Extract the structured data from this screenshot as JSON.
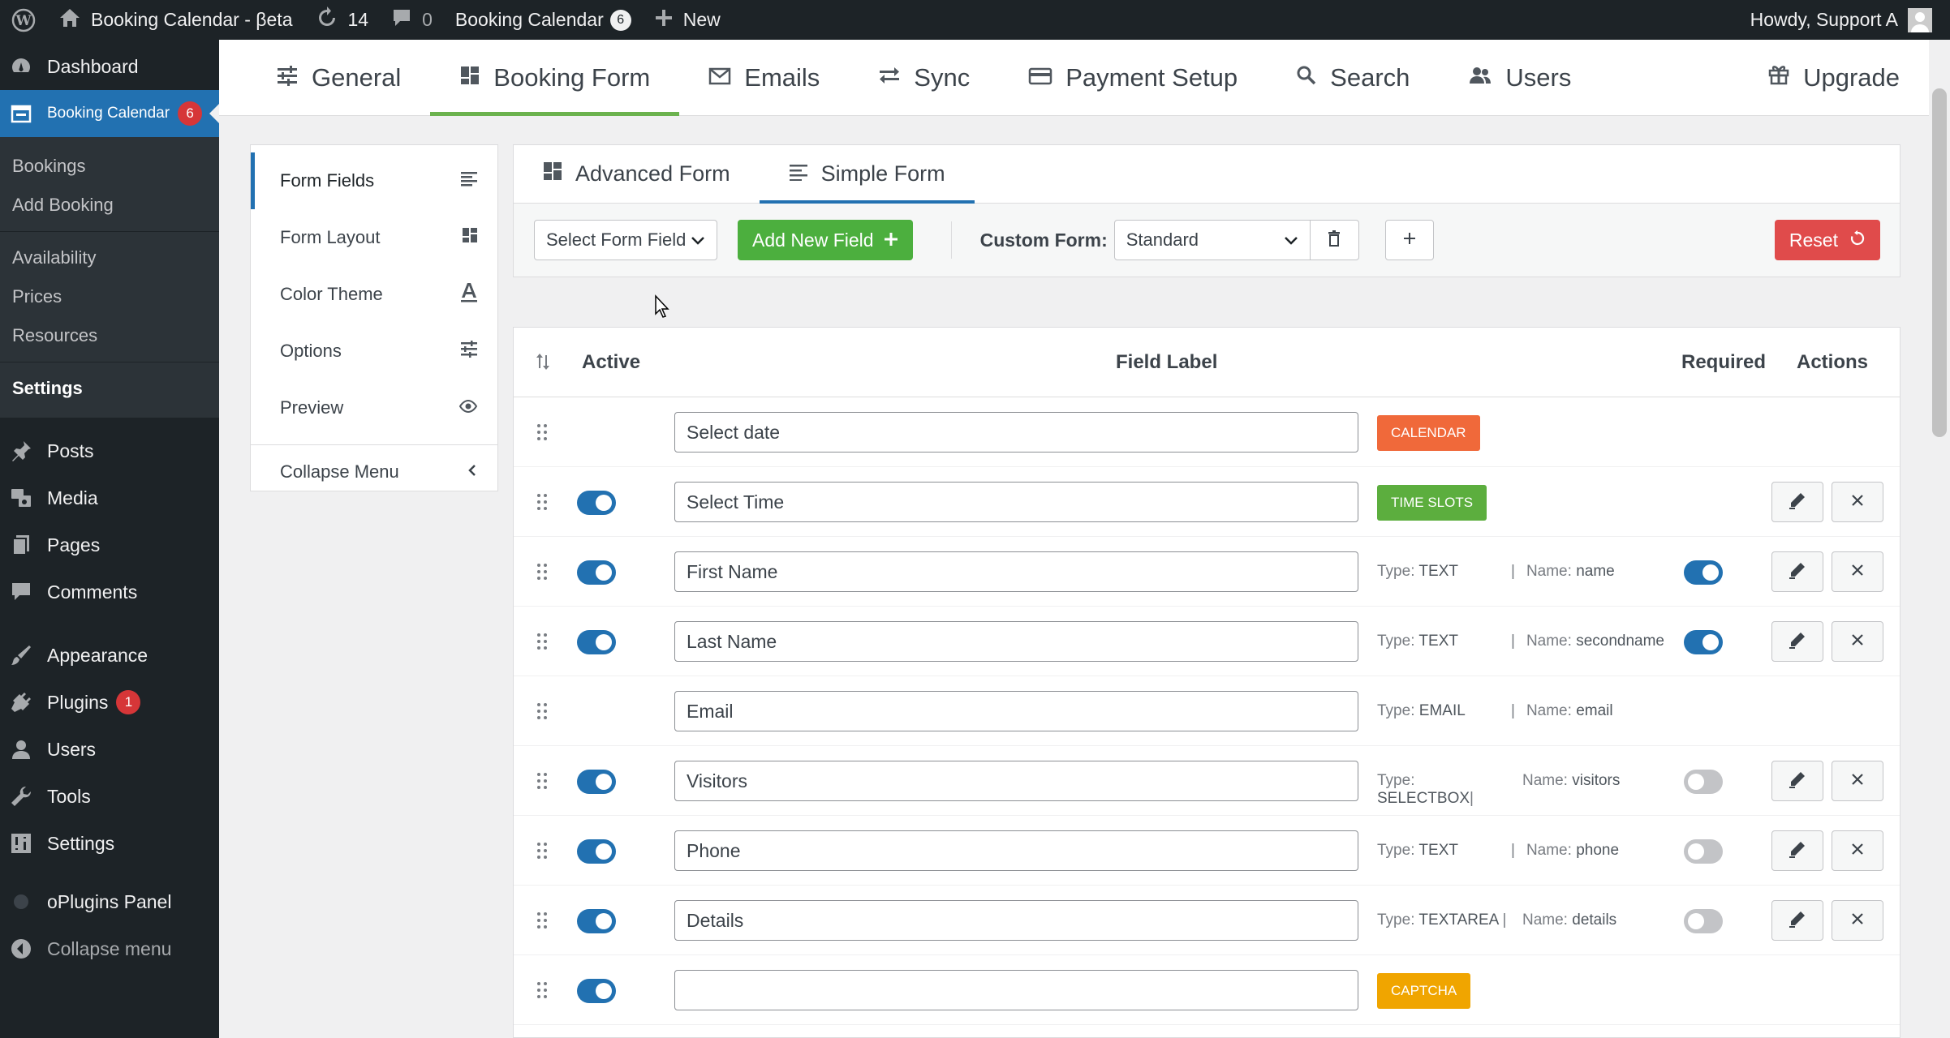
{
  "adminbar": {
    "site_name": "Booking Calendar - βeta",
    "updates_count": "14",
    "comments_count": "0",
    "plugin_label": "Booking Calendar",
    "plugin_count": "6",
    "new_label": "New",
    "greeting": "Howdy, Support A"
  },
  "sidebar": {
    "dashboard": "Dashboard",
    "booking_calendar": "Booking Calendar",
    "booking_calendar_badge": "6",
    "sub": {
      "bookings": "Bookings",
      "add_booking": "Add Booking",
      "availability": "Availability",
      "prices": "Prices",
      "resources": "Resources",
      "settings": "Settings"
    },
    "posts": "Posts",
    "media": "Media",
    "pages": "Pages",
    "comments": "Comments",
    "appearance": "Appearance",
    "plugins": "Plugins",
    "plugins_badge": "1",
    "users": "Users",
    "tools": "Tools",
    "settings": "Settings",
    "oplugins": "oPlugins Panel",
    "collapse": "Collapse menu"
  },
  "topnav": {
    "general": "General",
    "booking_form": "Booking Form",
    "emails": "Emails",
    "sync": "Sync",
    "payment_setup": "Payment Setup",
    "search": "Search",
    "users": "Users",
    "upgrade": "Upgrade"
  },
  "leftmenu": {
    "form_fields": "Form Fields",
    "form_layout": "Form Layout",
    "color_theme": "Color Theme",
    "options": "Options",
    "preview": "Preview",
    "collapse": "Collapse Menu"
  },
  "form_tabs": {
    "advanced": "Advanced Form",
    "simple": "Simple Form"
  },
  "toolbar": {
    "select_field": "Select Form Field",
    "add_new": "Add New Field",
    "custom_form_label": "Custom Form:",
    "custom_form_value": "Standard",
    "reset": "Reset"
  },
  "table": {
    "headers": {
      "active": "Active",
      "field_label": "Field Label",
      "required": "Required",
      "actions": "Actions"
    },
    "type_label": "Type:",
    "name_label": "Name:",
    "rows": [
      {
        "label": "Select date",
        "tag": "CALENDAR",
        "tag_color": "#f0693a"
      },
      {
        "label": "Select Time",
        "tag": "TIME SLOTS",
        "tag_color": "#5cae3e"
      },
      {
        "label": "First Name",
        "type": "TEXT",
        "name": "name"
      },
      {
        "label": "Last Name",
        "type": "TEXT",
        "name": "secondname"
      },
      {
        "label": "Email",
        "type": "EMAIL",
        "name": "email"
      },
      {
        "label": "Visitors",
        "type": "SELECTBOX",
        "name": "visitors"
      },
      {
        "label": "Phone",
        "type": "TEXT",
        "name": "phone"
      },
      {
        "label": "Details",
        "type": "TEXTAREA",
        "name": "details"
      },
      {
        "label": "",
        "tag": "CAPTCHA",
        "tag_color": "#f0a500"
      }
    ]
  }
}
